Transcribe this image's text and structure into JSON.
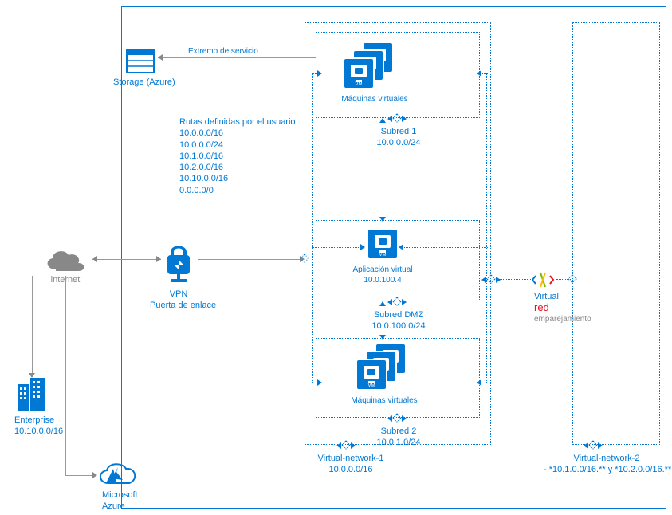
{
  "storage": {
    "label": "Storage (Azure)",
    "endpoint_label": "Extremo de servicio"
  },
  "routes": {
    "title": "Rutas definidas por el usuario",
    "items": [
      "10.0.0.0/16",
      "10.0.0.0/24",
      "10.1.0.0/16",
      "10.2.0.0/16",
      "10.10.0.0/16",
      "0.0.0.0/0"
    ]
  },
  "internet": {
    "label": "internet"
  },
  "vpn": {
    "label1": "VPN",
    "label2": "Puerta de enlace"
  },
  "enterprise": {
    "label": "Enterprise",
    "cidr": "10.10.0.0/16"
  },
  "azure": {
    "label1": "Microsoft",
    "label2": "Azure"
  },
  "subnet1": {
    "name": "Subred 1",
    "cidr": "10.0.0.0/24",
    "vm_label": "Máquinas virtuales"
  },
  "nva": {
    "subnet_name": "Subred DMZ",
    "subnet_cidr": "10.0.100.0/24",
    "app_label": "Aplicación virtual",
    "app_ip": "10.0.100.4"
  },
  "subnet2": {
    "name": "Subred 2",
    "cidr": "10.0.1.0/24",
    "vm_label": "Máquinas virtuales"
  },
  "vnet1": {
    "name": "Virtual-network-1",
    "cidr": "10.0.0.0/16"
  },
  "vnet2": {
    "name": "Virtual-network-2",
    "cidr": "- *10.1.0.0/16.** y *10.2.0.0/16.**."
  },
  "peering": {
    "l1": "Virtual",
    "l2": "red",
    "l3": "emparejamiento"
  }
}
